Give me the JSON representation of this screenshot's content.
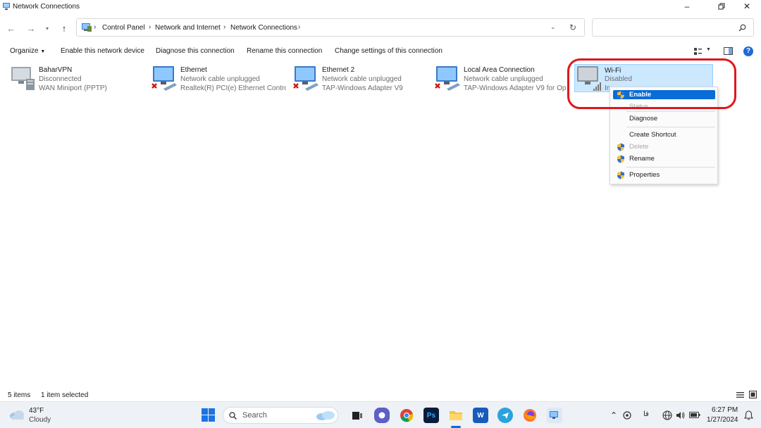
{
  "window": {
    "title": "Network Connections"
  },
  "address": {
    "crumbs": [
      "Control Panel",
      "Network and Internet",
      "Network Connections"
    ],
    "search_placeholder": ""
  },
  "commands": {
    "organize": "Organize",
    "enable": "Enable this network device",
    "diagnose": "Diagnose this connection",
    "rename": "Rename this connection",
    "change": "Change settings of this connection"
  },
  "connections": [
    {
      "name": "BaharVPN",
      "status": "Disconnected",
      "device": "WAN Miniport (PPTP)"
    },
    {
      "name": "Ethernet",
      "status": "Network cable unplugged",
      "device": "Realtek(R) PCI(e) Ethernet Control..."
    },
    {
      "name": "Ethernet 2",
      "status": "Network cable unplugged",
      "device": "TAP-Windows Adapter V9"
    },
    {
      "name": "Local Area Connection",
      "status": "Network cable unplugged",
      "device": "TAP-Windows Adapter V9 for Ope..."
    },
    {
      "name": "Wi-Fi",
      "status": "Disabled",
      "device": "In"
    }
  ],
  "context_menu": {
    "enable": "Enable",
    "status": "Status",
    "diagnose": "Diagnose",
    "create_shortcut": "Create Shortcut",
    "delete": "Delete",
    "rename": "Rename",
    "properties": "Properties"
  },
  "statusbar": {
    "items": "5 items",
    "selected": "1 item selected"
  },
  "taskbar": {
    "weather_temp": "43°F",
    "weather_desc": "Cloudy",
    "search_label": "Search",
    "time": "6:27 PM",
    "date": "1/27/2024",
    "lang": "فا",
    "ps_label": "Ps",
    "word_label": "W"
  },
  "colors": {
    "accent": "#0a6cd6",
    "selection": "#cce8ff",
    "callout": "#e0161a"
  }
}
